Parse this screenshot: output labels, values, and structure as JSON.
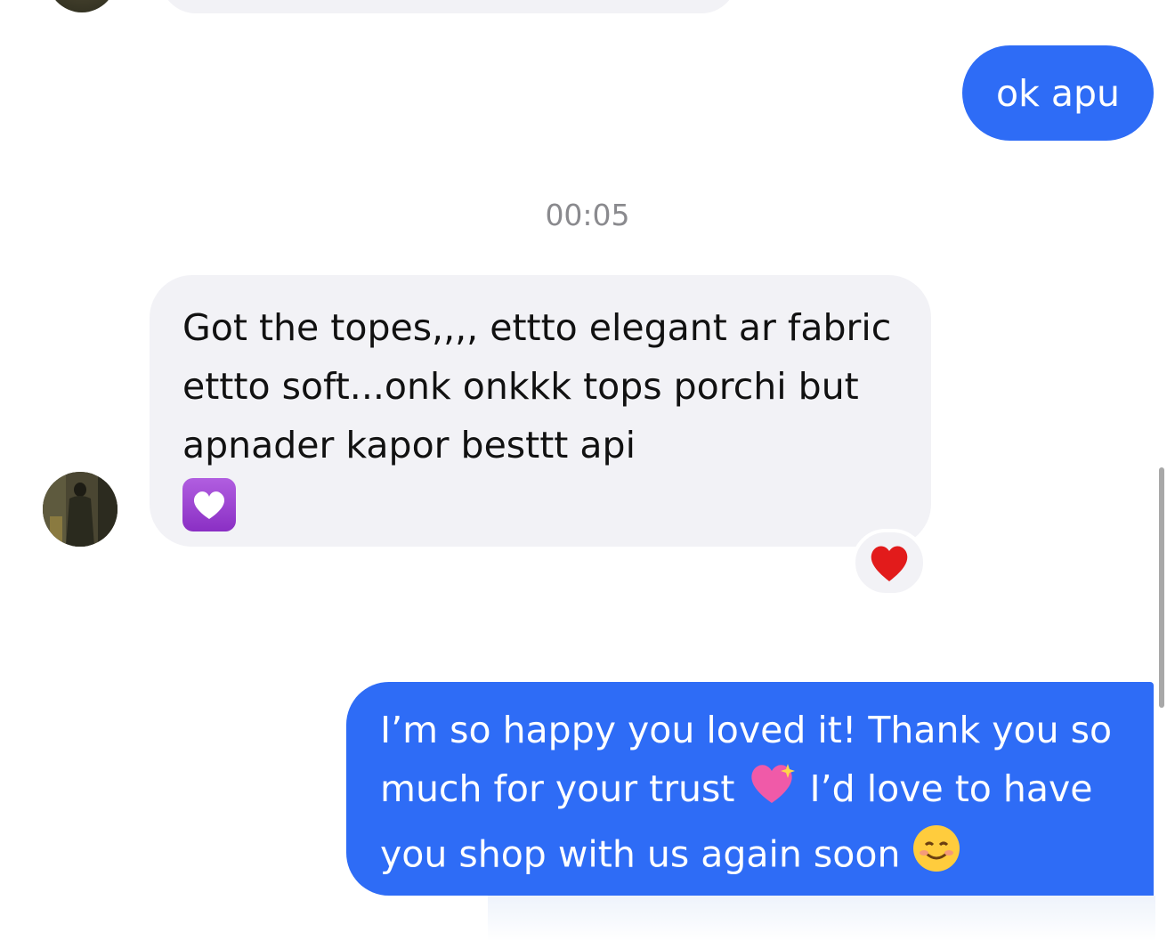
{
  "messages": {
    "sent_short": "ok apu",
    "timestamp": "00:05",
    "received_text": "Got the topes,,,, ettto elegant ar fabric ettto soft...onk onkkk tops porchi but apnader kapor besttt api",
    "received_emoji": "💟",
    "reaction_emoji": "❤️",
    "sent_long_part1": "I’m so happy you loved it! Thank you so much for your trust ",
    "sent_long_emoji1": "💖",
    "sent_long_part2": " I’d love to have you shop with us again soon ",
    "sent_long_emoji2": "😊"
  },
  "colors": {
    "sent_bubble": "#2e6cf6",
    "received_bubble": "#f2f2f6",
    "timestamp_text": "#8a8a8e"
  }
}
